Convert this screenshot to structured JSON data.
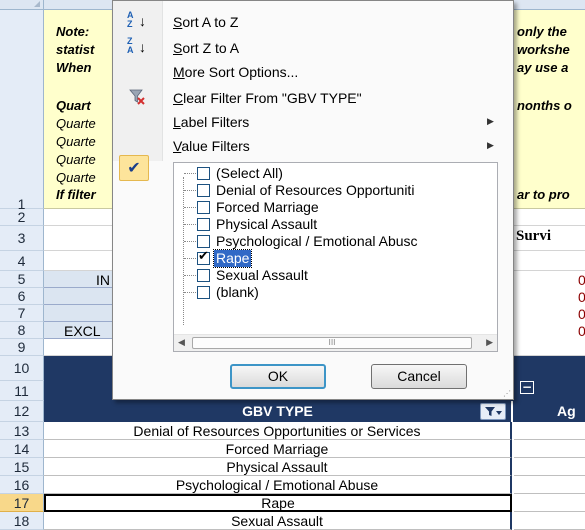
{
  "note": {
    "lines_left": [
      "Note:",
      "statist",
      "When",
      "",
      "Quart",
      "Quarte",
      "Quarte",
      "Quarte",
      "Quarte",
      "If filter"
    ],
    "lines_right": [
      "only the",
      "workshe",
      "ay use a",
      "",
      "nonths o",
      "",
      "",
      "",
      "",
      "ar to pro"
    ]
  },
  "row_headers": [
    "1",
    "2",
    "3",
    "4",
    "5",
    "6",
    "7",
    "8",
    "9",
    "10",
    "11",
    "12",
    "13",
    "14",
    "15",
    "16",
    "17",
    "18"
  ],
  "cells": {
    "row5_left": "IN",
    "row8_left": "EXCL",
    "survivor": "Survi",
    "red_values": [
      "0",
      "0",
      "0",
      "0"
    ]
  },
  "table": {
    "header": "GBV TYPE",
    "age_header": "Ag",
    "collapse_symbol": "−",
    "rows": [
      "Denial of Resources Opportunities or Services",
      "Forced Marriage",
      "Physical Assault",
      "Psychological / Emotional Abuse",
      "Rape",
      "Sexual Assault"
    ]
  },
  "menu": {
    "sort_az": "Sort A to Z",
    "sort_za": "Sort Z to A",
    "more_sort": "More Sort Options...",
    "clear_filter": "Clear Filter From \"GBV TYPE\"",
    "label_filters": "Label Filters",
    "value_filters": "Value Filters",
    "icons": {
      "sort_az": "sort-ascending-icon",
      "sort_za": "sort-descending-icon",
      "clear_filter": "clear-filter-icon",
      "value_filter_check": "checkmark-icon"
    }
  },
  "filter_list": {
    "items": [
      {
        "label": "(Select All)",
        "checked": false
      },
      {
        "label": "Denial of Resources Opportuniti",
        "checked": false
      },
      {
        "label": "Forced Marriage",
        "checked": false
      },
      {
        "label": "Physical Assault",
        "checked": false
      },
      {
        "label": "Psychological / Emotional Abusc",
        "checked": false
      },
      {
        "label": "Rape",
        "checked": true
      },
      {
        "label": "Sexual Assault",
        "checked": false
      },
      {
        "label": "(blank)",
        "checked": false
      }
    ],
    "scroll_thumb_label": "III"
  },
  "buttons": {
    "ok": "OK",
    "cancel": "Cancel"
  },
  "colors": {
    "header_navy": "#1f3864",
    "note_yellow": "#ffffcc",
    "selection_blue": "#3169c6",
    "checked_gold": "#fde49b"
  }
}
